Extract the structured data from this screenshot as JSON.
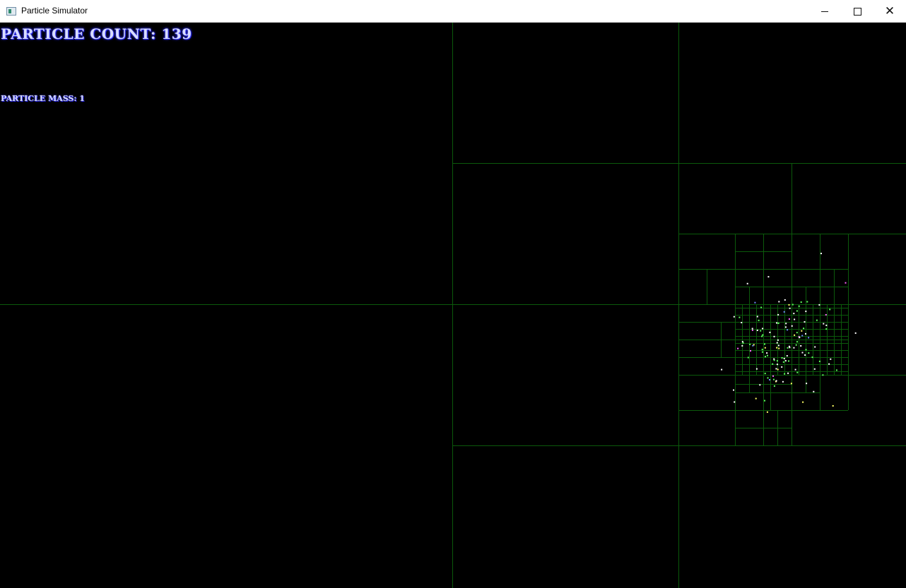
{
  "window": {
    "title": "Particle Simulator",
    "icon": "app-window-icon",
    "controls": [
      "minimize",
      "maximize",
      "close"
    ]
  },
  "hud": {
    "particle_count_text": "PARTICLE COUNT: 139",
    "particle_mass_text": "PARTICLE MASS: 1"
  },
  "simulation": {
    "particle_count": 139,
    "particle_mass": 1,
    "colors": {
      "background": "#000000",
      "quadtree_lines": "#0b5a0b",
      "hud_text": "#d9ddff",
      "hud_glow": "#2a2aff",
      "particle_colors": [
        "#ffffff",
        "#5cff5c",
        "#ff66ff",
        "#ffff66",
        "#6f8cff"
      ]
    }
  }
}
